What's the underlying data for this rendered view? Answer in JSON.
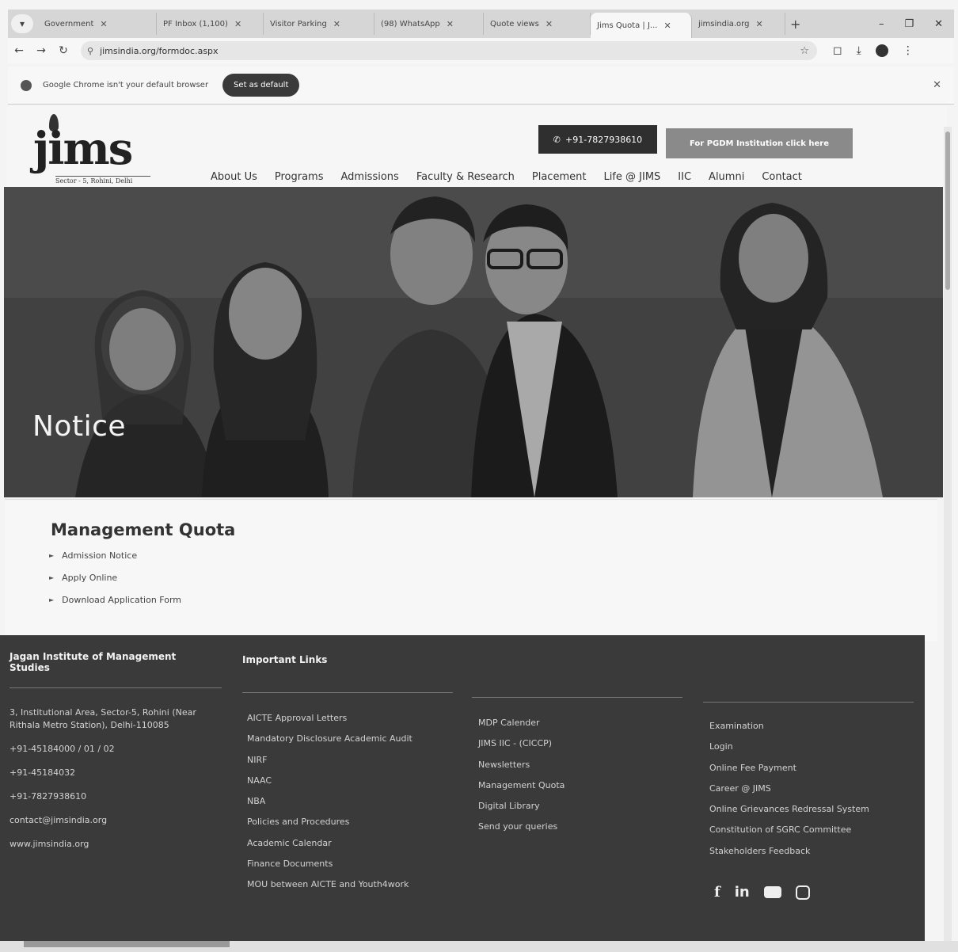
{
  "browser": {
    "tabs": [
      {
        "label": "Government",
        "active": false
      },
      {
        "label": "PF Inbox (1,100)",
        "active": false
      },
      {
        "label": "Visitor Parking",
        "active": false
      },
      {
        "label": "(98) WhatsApp",
        "active": false
      },
      {
        "label": "Quote views",
        "active": false
      },
      {
        "label": "Jims Quota | J...",
        "active": true
      },
      {
        "label": "jimsindia.org",
        "active": false
      }
    ],
    "url": "jimsindia.org/formdoc.aspx",
    "default_browser_message": "Google Chrome isn't your default browser",
    "set_default_label": "Set as default"
  },
  "header": {
    "logo_text": "jims",
    "logo_subtitle": "Sector - 5, Rohini, Delhi",
    "phone_button": "+91-7827938610",
    "pgdm_button": "For PGDM Institution click here",
    "nav": [
      "About Us",
      "Programs",
      "Admissions",
      "Faculty & Research",
      "Placement",
      "Life @ JIMS",
      "IIC",
      "Alumni",
      "Contact"
    ]
  },
  "hero": {
    "title": "Notice"
  },
  "content": {
    "title": "Management Quota",
    "links": [
      "Admission Notice",
      "Apply Online",
      "Download Application Form"
    ]
  },
  "footer": {
    "org_name": "Jagan Institute of Management Studies",
    "important_links_title": "Important Links",
    "address": "3, Institutional Area, Sector-5, Rohini (Near Rithala Metro Station), Delhi-110085",
    "phones": [
      "+91-45184000 / 01 / 02",
      "+91-45184032",
      "+91-7827938610"
    ],
    "email": "contact@jimsindia.org",
    "website": "www.jimsindia.org",
    "links_col1": [
      "AICTE Approval Letters",
      "Mandatory Disclosure Academic Audit",
      "NIRF",
      "NAAC",
      "NBA",
      "Policies and Procedures",
      "Academic Calendar",
      "Finance Documents",
      "MOU between AICTE and Youth4work"
    ],
    "links_col2": [
      "MDP Calender",
      "JIMS IIC - (CICCP)",
      "Newsletters",
      "Management Quota",
      "Digital Library",
      "Send your queries"
    ],
    "links_col3": [
      "Examination",
      "Login",
      "Online Fee Payment",
      "Career @ JIMS",
      "Online Grievances Redressal System",
      "Constitution of SGRC Committee",
      "Stakeholders Feedback"
    ]
  }
}
